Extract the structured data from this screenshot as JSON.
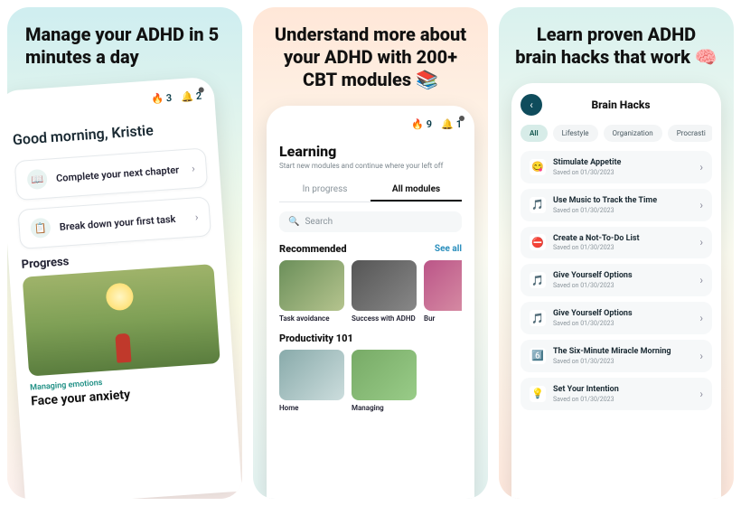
{
  "panel1": {
    "headline": "Manage your ADHD in 5 minutes a day",
    "streak": "3",
    "notifications": "2",
    "greeting": "Good morning, Kristie",
    "task1": "Complete your next chapter",
    "task2": "Break down your first task",
    "progress_label": "Progress",
    "category": "Managing emotions",
    "progress_title": "Face your anxiety"
  },
  "panel2": {
    "headline": "Understand more about your ADHD with 200+ CBT modules 📚",
    "streak": "9",
    "notifications": "1",
    "title": "Learning",
    "subtitle": "Start new modules and continue where your left off",
    "tab_in_progress": "In progress",
    "tab_all": "All modules",
    "search_placeholder": "Search",
    "recommended_label": "Recommended",
    "see_all": "See all",
    "mod1": "Task avoidance",
    "mod2": "Success with ADHD",
    "mod3": "Bur",
    "section2": "Productivity 101",
    "mod4": "Home",
    "mod5": "Managing"
  },
  "panel3": {
    "headline": "Learn proven ADHD brain hacks that work 🧠",
    "nav_title": "Brain Hacks",
    "chip_all": "All",
    "chip_lifestyle": "Lifestyle",
    "chip_org": "Organization",
    "chip_proc": "Procrasti",
    "hacks": [
      {
        "icon": "😋",
        "title": "Stimulate Appetite",
        "saved": "Saved on 01/30/2023"
      },
      {
        "icon": "🎵",
        "title": "Use Music to Track the Time",
        "saved": "Saved on 01/30/2023"
      },
      {
        "icon": "⛔",
        "title": "Create a Not-To-Do List",
        "saved": "Saved on 01/30/2023"
      },
      {
        "icon": "🎵",
        "title": "Give Yourself Options",
        "saved": "Saved on 01/30/2023"
      },
      {
        "icon": "🎵",
        "title": "Give Yourself Options",
        "saved": "Saved on 01/30/2023"
      },
      {
        "icon": "6️⃣",
        "title": "The Six-Minute Miracle Morning",
        "saved": "Saved on 01/30/2023"
      },
      {
        "icon": "💡",
        "title": "Set Your Intention",
        "saved": "Saved on 01/30/2023"
      }
    ]
  }
}
